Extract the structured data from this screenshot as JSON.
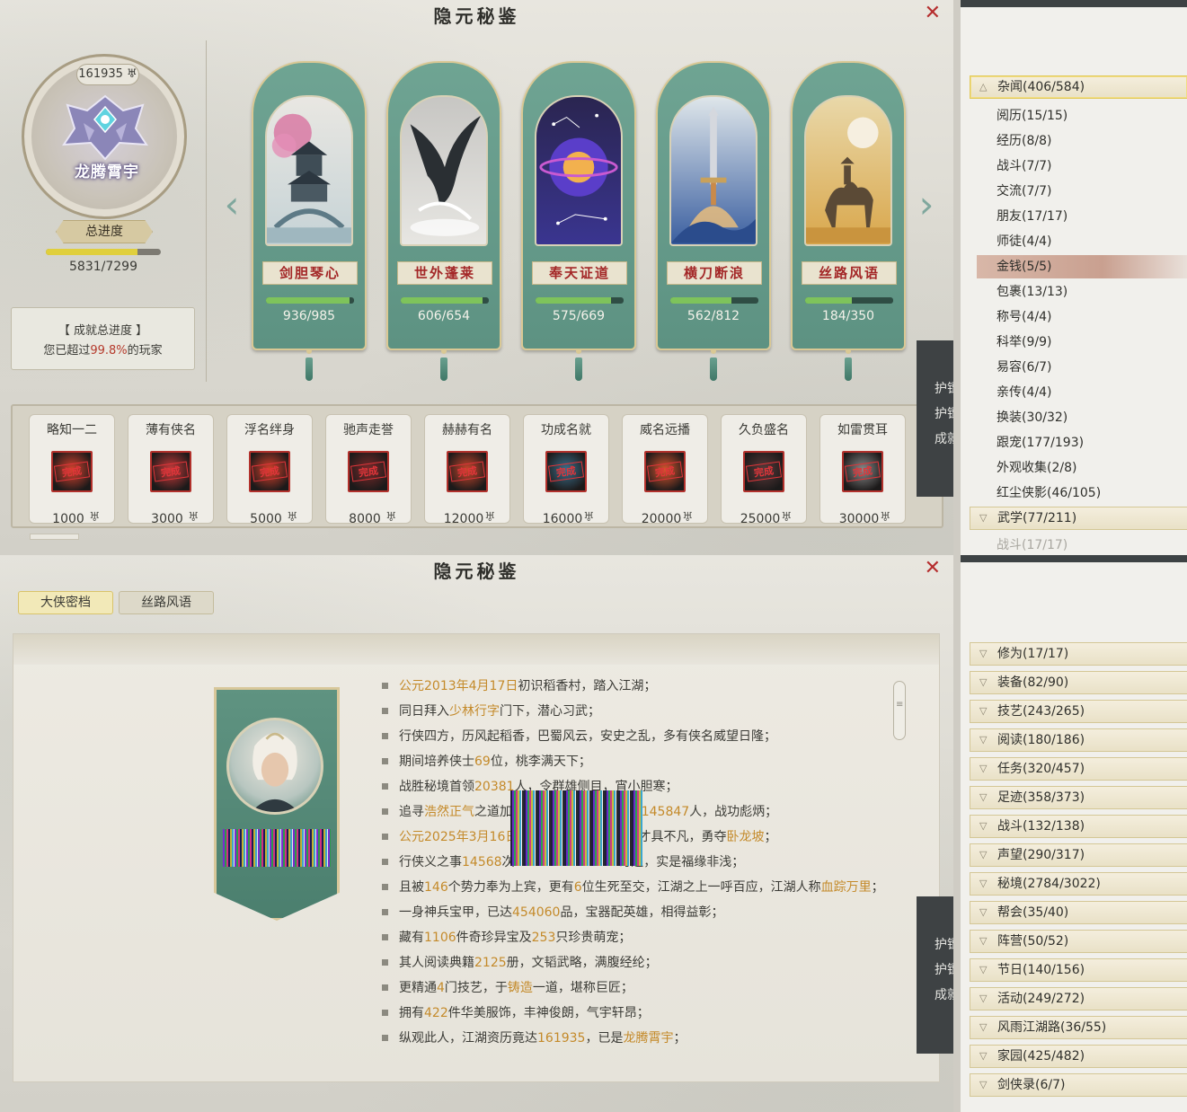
{
  "window": {
    "title": "隐元秘鉴",
    "close_label": "✕"
  },
  "overview": {
    "score": "161935",
    "title_name": "龙腾霄宇",
    "total_label": "总进度",
    "total_count": "5831/7299",
    "total_progress": 0.7986,
    "achv_title": "【 成就总进度 】",
    "achv_prefix": "您已超过",
    "achv_pct": "99.8%",
    "achv_suffix": "的玩家"
  },
  "cards": [
    {
      "name": "剑胆琴心",
      "count": "936/985",
      "progress": 0.95
    },
    {
      "name": "世外蓬莱",
      "count": "606/654",
      "progress": 0.927
    },
    {
      "name": "奉天证道",
      "count": "575/669",
      "progress": 0.86
    },
    {
      "name": "横刀断浪",
      "count": "562/812",
      "progress": 0.692
    },
    {
      "name": "丝路风语",
      "count": "184/350",
      "progress": 0.526
    }
  ],
  "tiers": [
    {
      "name": "略知一二",
      "value": "1000",
      "status": "完成"
    },
    {
      "name": "薄有侠名",
      "value": "3000",
      "status": "完成"
    },
    {
      "name": "浮名绊身",
      "value": "5000",
      "status": "完成"
    },
    {
      "name": "驰声走誉",
      "value": "8000",
      "status": "完成"
    },
    {
      "name": "赫赫有名",
      "value": "12000",
      "status": "完成"
    },
    {
      "name": "功成名就",
      "value": "16000",
      "status": "完成"
    },
    {
      "name": "威名远播",
      "value": "20000",
      "status": "完成"
    },
    {
      "name": "久负盛名",
      "value": "25000",
      "status": "完成"
    },
    {
      "name": "如雷贯耳",
      "value": "30000",
      "status": "完成"
    }
  ],
  "side_tab_top": [
    "护镖",
    "护镖",
    "成就"
  ],
  "side_tab_bottom": [
    "护镖",
    "护镖",
    "成就"
  ],
  "tabs": {
    "active": "大侠密档",
    "inactive": "丝路风语"
  },
  "bio_lines": [
    [
      {
        "t": "公元2013年4月17日",
        "h": true
      },
      {
        "t": "初识稻香村，踏入江湖；"
      }
    ],
    [
      {
        "t": "同日拜入"
      },
      {
        "t": "少林行字",
        "h": true
      },
      {
        "t": "门下，潜心习武；"
      }
    ],
    [
      {
        "t": "行侠四方，历风起稻香，巴蜀风云，安史之乱，多有侠名威望日隆；"
      }
    ],
    [
      {
        "t": "期间培养侠士"
      },
      {
        "t": "69",
        "h": true
      },
      {
        "t": "位，桃李满天下；"
      }
    ],
    [
      {
        "t": "战胜秘境首领"
      },
      {
        "t": "20381",
        "h": true
      },
      {
        "t": "人，令群雄侧目，宵小胆寒；"
      }
    ],
    [
      {
        "t": "追寻"
      },
      {
        "t": "浩然正气",
        "h": true
      },
      {
        "t": "之道加"
      },
      {
        "t": "                          "
      },
      {
        "t": "阵营"
      },
      {
        "t": "145847",
        "h": true
      },
      {
        "t": "人，战功彪炳；"
      }
    ],
    [
      {
        "t": "公元2025年3月16日",
        "h": true
      },
      {
        "t": "                           "
      },
      {
        "t": "，才具不凡，勇夺"
      },
      {
        "t": "卧龙坡",
        "h": true
      },
      {
        "t": "；"
      }
    ],
    [
      {
        "t": "行侠义之事"
      },
      {
        "t": "14568",
        "h": true
      },
      {
        "t": "次"
      },
      {
        "t": "                          "
      },
      {
        "t": "奇遇，实是福缘非浅；"
      }
    ],
    [
      {
        "t": "且被"
      },
      {
        "t": "146",
        "h": true
      },
      {
        "t": "个势力奉为上宾，更有"
      },
      {
        "t": "6",
        "h": true
      },
      {
        "t": "位生死至交，江湖之上一呼百应，江湖人称"
      },
      {
        "t": "血踪万里",
        "h": true
      },
      {
        "t": "；"
      }
    ],
    [
      {
        "t": "一身神兵宝甲，已达"
      },
      {
        "t": "454060",
        "h": true
      },
      {
        "t": "品，宝器配英雄，相得益彰；"
      }
    ],
    [
      {
        "t": "藏有"
      },
      {
        "t": "1106",
        "h": true
      },
      {
        "t": "件奇珍异宝及"
      },
      {
        "t": "253",
        "h": true
      },
      {
        "t": "只珍贵萌宠；"
      }
    ],
    [
      {
        "t": "其人阅读典籍"
      },
      {
        "t": "2125",
        "h": true
      },
      {
        "t": "册，文韬武略，满腹经纶；"
      }
    ],
    [
      {
        "t": "更精通"
      },
      {
        "t": "4",
        "h": true
      },
      {
        "t": "门技艺，于"
      },
      {
        "t": "铸造",
        "h": true
      },
      {
        "t": "一道，堪称巨匠；"
      }
    ],
    [
      {
        "t": "拥有"
      },
      {
        "t": "422",
        "h": true
      },
      {
        "t": "件华美服饰，丰神俊朗，气宇轩昂；"
      }
    ],
    [
      {
        "t": "纵观此人，江湖资历竟达"
      },
      {
        "t": "161935",
        "h": true
      },
      {
        "t": "，已是"
      },
      {
        "t": "龙腾霄宇",
        "h": true
      },
      {
        "t": "；"
      }
    ]
  ],
  "sidebar_top": {
    "open_category": "杂闻(406/584)",
    "sub_items": [
      "阅历(15/15)",
      "经历(8/8)",
      "战斗(7/7)",
      "交流(7/7)",
      "朋友(17/17)",
      "师徒(4/4)",
      "金钱(5/5)",
      "包裹(13/13)",
      "称号(4/4)",
      "科举(9/9)",
      "易容(6/7)",
      "亲传(4/4)",
      "换装(30/32)",
      "跟宠(177/193)",
      "外观收集(2/8)",
      "红尘侠影(46/105)"
    ],
    "selected": "金钱(5/5)",
    "next_category": "武学(77/211)",
    "partial_text": "战斗(17/17)"
  },
  "sidebar_bottom": {
    "categories": [
      "修为(17/17)",
      "装备(82/90)",
      "技艺(243/265)",
      "阅读(180/186)",
      "任务(320/457)",
      "足迹(358/373)",
      "战斗(132/138)",
      "声望(290/317)",
      "秘境(2784/3022)",
      "帮会(35/40)",
      "阵营(50/52)",
      "节日(140/156)",
      "活动(249/272)",
      "风雨江湖路(36/55)",
      "家园(425/482)",
      "剑侠录(6/7)"
    ]
  },
  "colors": {
    "accent_green": "#6fa493",
    "highlight_orange": "#c48a2a",
    "close_red": "#b52d2d",
    "progress_green": "#7ec35b"
  }
}
